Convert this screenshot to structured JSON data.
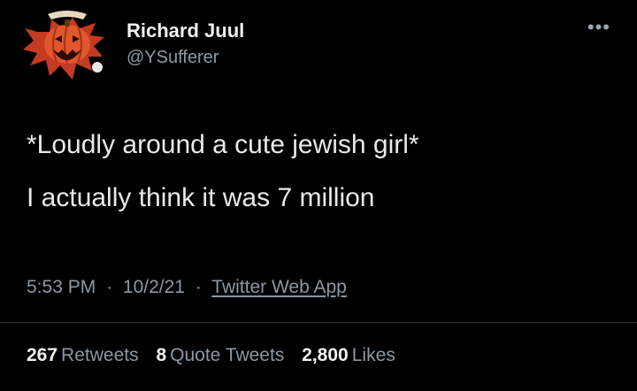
{
  "tweet": {
    "author": {
      "display_name": "Richard Juul",
      "handle": "@YSufferer",
      "avatar_icon": "pumpkin-mascot-avatar"
    },
    "more_icon": "more-dots-icon",
    "body": {
      "line1": "*Loudly around a cute jewish girl*",
      "line2": "I actually think it was 7 million"
    },
    "meta": {
      "time": "5:53 PM",
      "date": "10/2/21",
      "separator": "·",
      "source": "Twitter Web App"
    },
    "stats": {
      "retweets_count": "267",
      "retweets_label": "Retweets",
      "quote_count": "8",
      "quote_label": "Quote Tweets",
      "likes_count": "2,800",
      "likes_label": "Likes"
    }
  },
  "colors": {
    "background": "#000000",
    "text_primary": "#e7e9ea",
    "text_secondary": "#8b98a5",
    "divider": "#2f3336",
    "avatar_accent": "#d8492c"
  }
}
